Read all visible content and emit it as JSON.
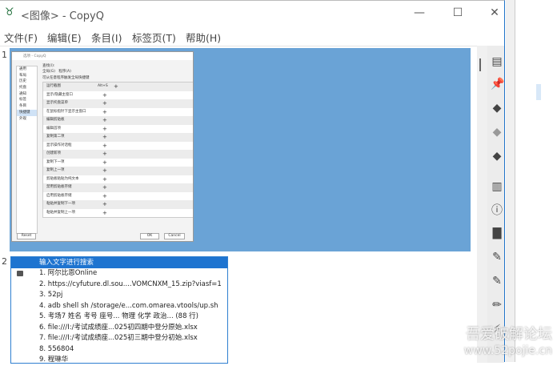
{
  "window": {
    "title": "<图像> - CopyQ",
    "app_icon": "copyq-logo-icon",
    "controls": {
      "minimize": "—",
      "maximize": "☐",
      "close": "✕"
    }
  },
  "menu": [
    "文件(F)",
    "编辑(E)",
    "条目(I)",
    "标签页(T)",
    "帮助(H)"
  ],
  "items": [
    {
      "number": "1",
      "type": "image",
      "image": {
        "title": "选项 - CopyQ",
        "sidebar": [
          "通用",
          "布局",
          "历史",
          "托盘",
          "通知",
          "标签",
          "条目",
          "快捷键",
          "外观"
        ],
        "selected_sidebar": "快捷键",
        "search_label": "查找(I):",
        "tabs": [
          "全局(G)",
          "程序(A)"
        ],
        "hint": "可从任意程序触发全局快捷键",
        "rows": [
          "运行截图",
          "显示/隐藏主窗口",
          "显示托盘菜单",
          "在鼠标指针下显示主窗口",
          "编辑剪贴板",
          "编辑首项",
          "复制第二项",
          "显示操作对话框",
          "创建新项",
          "复制下一项",
          "复制上一项",
          "剪贴板粘贴为纯文本",
          "禁用剪贴板存储",
          "启用剪贴板存储",
          "粘贴并复制下一项",
          "粘贴并复制上一项"
        ],
        "first_shortcut": "Alt+S",
        "buttons": {
          "reset": "Reset",
          "ok": "OK",
          "cancel": "Cancel"
        }
      }
    },
    {
      "number": "2",
      "type": "menu",
      "search_placeholder": "输入文字进行搜索",
      "entries": [
        "1. 阿尔比恩Online",
        "2. https://cyfuture.dl.sou....VOMCNXM_15.zip?viasf=1",
        "3. 52pj",
        "4. adb shell sh /storage/e...com.omarea.vtools/up.sh",
        "5. 考场7 姓名 考号 座号... 物理 化学 政治... (88 行)",
        "6. file:///I:/考试成绩座...025初四期中登分原始.xlsx",
        "7. file:///I:/考试成绩座...025初三期中登分初始.xlsx",
        "8. 556804",
        "9. 程琳华"
      ]
    }
  ],
  "toolbar": [
    "new-item-icon",
    "pin-icon",
    "tag-icon",
    "tag-disabled-icon",
    "tag-icon",
    "clipboard-icon",
    "info-icon",
    "trash-icon",
    "edit-icon",
    "edit-notes-icon",
    "pencil-icon",
    "action-icon"
  ],
  "watermark": {
    "line1": "吾爱破解论坛",
    "line2": "www.52pojie.cn"
  },
  "colors": {
    "selection": "#6aa3d6",
    "accent": "#1e74d0"
  }
}
